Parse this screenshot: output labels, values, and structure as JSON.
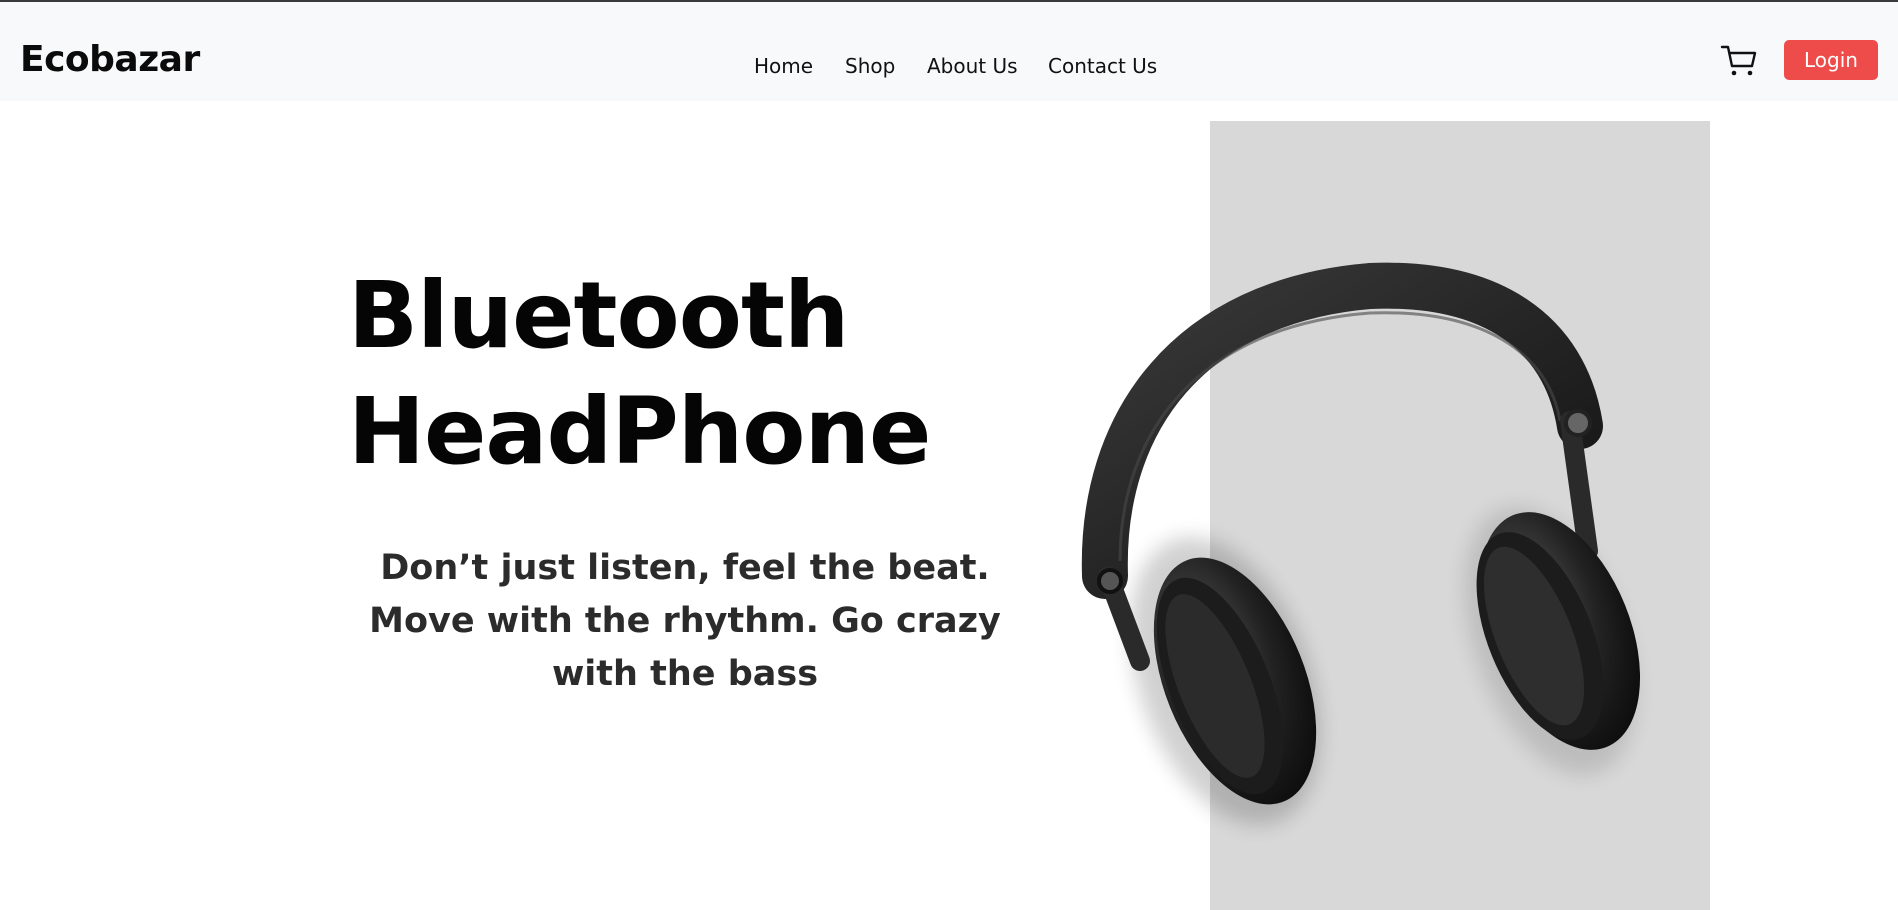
{
  "navbar": {
    "brand": "Ecobazar",
    "links": [
      {
        "label": "Home"
      },
      {
        "label": "Shop"
      },
      {
        "label": "About Us"
      },
      {
        "label": "Contact Us"
      }
    ],
    "cart_icon": "shopping-cart-icon",
    "login_label": "Login"
  },
  "hero": {
    "title_line1": "Bluetooth",
    "title_line2": "HeadPhone",
    "subtitle": "Don’t just listen, feel the beat. Move with the rhythm. Go crazy with the bass",
    "image": "headphones-product-image"
  },
  "colors": {
    "accent": "#ee4b4b",
    "navbar_bg": "#f8f9fa",
    "panel_bg": "#d8d8d8",
    "text": "#050505"
  }
}
